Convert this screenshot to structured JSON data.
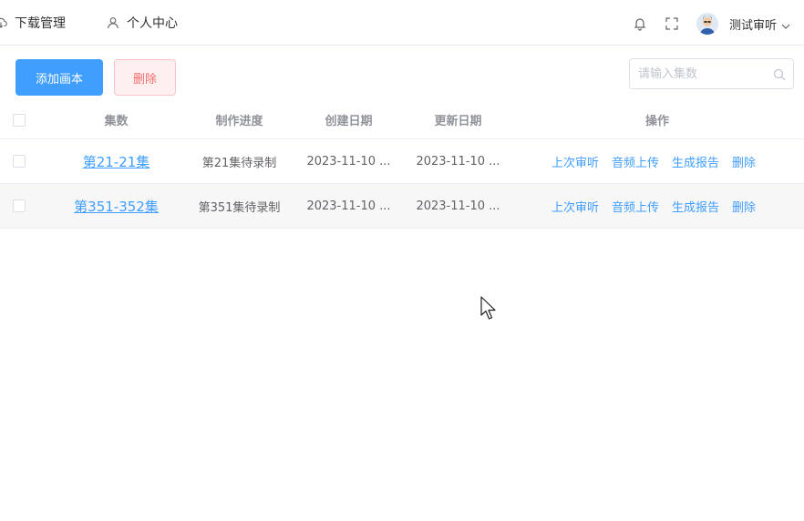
{
  "nav": {
    "download_label": "下载管理",
    "profile_label": "个人中心"
  },
  "user": {
    "name": "测试审听"
  },
  "toolbar": {
    "add_label": "添加画本",
    "delete_label": "删除"
  },
  "search": {
    "placeholder": "请输入集数",
    "value": ""
  },
  "table": {
    "columns": [
      "集数",
      "制作进度",
      "创建日期",
      "更新日期",
      "操作"
    ],
    "rows": [
      {
        "episode": "第21-21集",
        "progress": "第21集待录制",
        "created": "2023-11-10 ...",
        "updated": "2023-11-10 ...",
        "actions": [
          "上次审听",
          "音频上传",
          "生成报告",
          "删除"
        ]
      },
      {
        "episode": "第351-352集",
        "progress": "第351集待录制",
        "created": "2023-11-10 ...",
        "updated": "2023-11-10 ...",
        "actions": [
          "上次审听",
          "音频上传",
          "生成报告",
          "删除"
        ]
      }
    ]
  },
  "icons": {
    "download": "cloud-download-icon",
    "profile": "user-icon",
    "bell": "bell-icon",
    "fullscreen": "fullscreen-icon",
    "caret": "chevron-down-icon",
    "search": "search-icon"
  },
  "colors": {
    "primary": "#409eff",
    "danger": "#f56c6c",
    "danger_bg": "#fef0f0"
  }
}
